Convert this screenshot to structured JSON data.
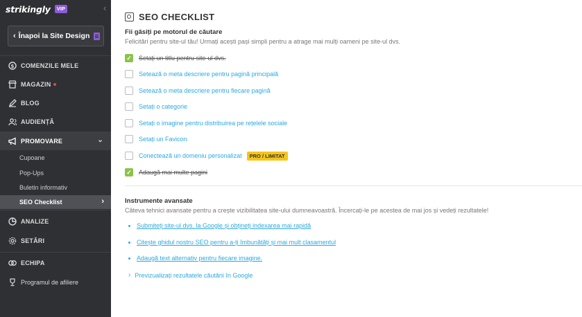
{
  "sidebar": {
    "brand": "strikingly",
    "vip_badge": "VIP",
    "collapse_glyph": "‹",
    "back_button": "Înapoi la Site Design",
    "nav": [
      {
        "label": "COMENZILE MELE",
        "icon": "dollar-icon"
      },
      {
        "label": "MAGAZIN",
        "icon": "store-icon"
      },
      {
        "label": "BLOG",
        "icon": "pen-icon"
      },
      {
        "label": "AUDIENȚĂ",
        "icon": "people-icon"
      },
      {
        "label": "PROMOVARE",
        "icon": "megaphone-icon"
      }
    ],
    "subnav": [
      {
        "label": "Cupoane"
      },
      {
        "label": "Pop-Ups"
      },
      {
        "label": "Buletin informativ"
      },
      {
        "label": "SEO Checklist"
      }
    ],
    "nav2": [
      {
        "label": "ANALIZE",
        "icon": "chart-icon"
      },
      {
        "label": "SETĂRI",
        "icon": "gear-icon"
      },
      {
        "label": "ECHIPA",
        "icon": "team-icon"
      },
      {
        "label": "Programul de afiliere",
        "icon": "trophy-icon"
      }
    ]
  },
  "main": {
    "title": "SEO CHECKLIST",
    "section1": {
      "heading": "Fii găsiți pe motorul de căutare",
      "desc": "Felicitări pentru site-ul tău! Urmați acești pași simpli pentru a atrage mai mulți oameni pe site-ul dvs.",
      "items": [
        {
          "label": "Setați un titlu pentru site-ul dvs.",
          "done": true
        },
        {
          "label": "Setează o meta descriere pentru pagină principală",
          "done": false
        },
        {
          "label": "Setează o meta descriere pentru fiecare pagină",
          "done": false
        },
        {
          "label": "Setați o categorie",
          "done": false
        },
        {
          "label": "Setați o imagine pentru distribuirea pe rețelele sociale",
          "done": false
        },
        {
          "label": "Setați un Favicon",
          "done": false
        },
        {
          "label": "Conectează un domeniu personalizat",
          "done": false,
          "badge": "PRO / LIMITAT"
        },
        {
          "label": "Adaugă mai multe pagini",
          "done": true
        }
      ]
    },
    "section2": {
      "heading": "Instrumente avansate",
      "desc": "Câteva tehnici avansate pentru a crește vizibilitatea site-ului dumneavoastră. Încercați-le pe acestea de mai jos și vedeți rezultatele!",
      "links": [
        "Submiteți site-ul dvs. la Google și obțineți indexarea mai rapidă",
        "Citește ghidul nostru SEO pentru a-ți îmbunătăți și mai mult clasamentul",
        "Adaugă text alternativ pentru fiecare imagine."
      ],
      "preview": "Previzualizați rezultatele căutării în Google"
    }
  },
  "colors": {
    "sidebar_bg": "#2f3033",
    "accent_link": "#2aa9e0",
    "check_done": "#8bc34a",
    "vip": "#8e5cd9",
    "pro_badge": "#f5c518"
  }
}
